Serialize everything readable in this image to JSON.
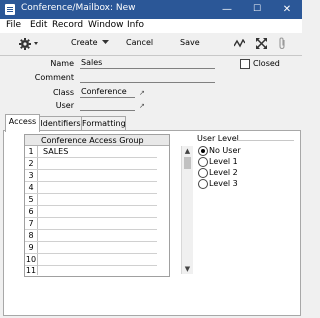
{
  "window": {
    "title": "Conference/Mailbox: New",
    "controls": {
      "minimize": "—",
      "maximize": "☐",
      "close": "✕"
    }
  },
  "menubar": {
    "items": [
      "File",
      "Edit",
      "Record",
      "Window",
      "Info"
    ]
  },
  "toolbar": {
    "settings_icon": "gear-icon",
    "create_label": "Create",
    "cancel_label": "Cancel",
    "save_label": "Save"
  },
  "form": {
    "name_label": "Name",
    "name_value": "Sales",
    "comment_label": "Comment",
    "comment_value": "",
    "class_label": "Class",
    "class_value": "Conference",
    "user_label": "User",
    "user_value": "",
    "closed_label": "Closed"
  },
  "tabs": [
    "Access",
    "Identifiers",
    "Formatting"
  ],
  "grid": {
    "header": "Conference Access Group",
    "rows": [
      {
        "num": "1",
        "value": "SALES"
      },
      {
        "num": "2",
        "value": ""
      },
      {
        "num": "3",
        "value": ""
      },
      {
        "num": "4",
        "value": ""
      },
      {
        "num": "5",
        "value": ""
      },
      {
        "num": "6",
        "value": ""
      },
      {
        "num": "7",
        "value": ""
      },
      {
        "num": "8",
        "value": ""
      },
      {
        "num": "9",
        "value": ""
      },
      {
        "num": "10",
        "value": ""
      },
      {
        "num": "11",
        "value": ""
      }
    ]
  },
  "user_level": {
    "title": "User Level",
    "options": [
      "No User",
      "Level 1",
      "Level 2",
      "Level 3"
    ],
    "selected": "No User"
  }
}
